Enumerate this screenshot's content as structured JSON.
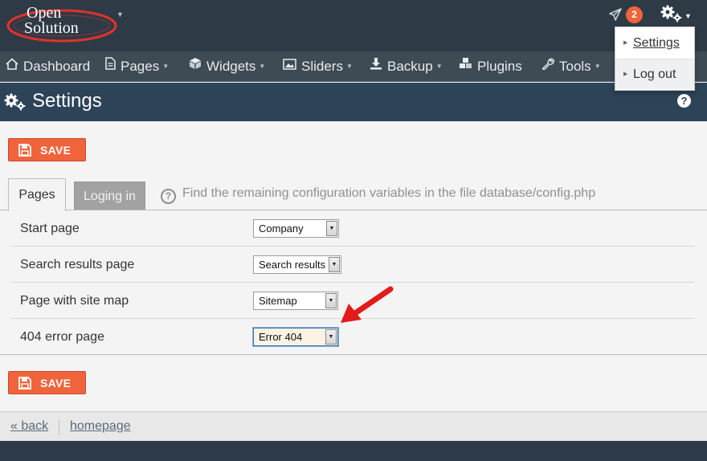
{
  "brand": {
    "logo_line1": "Open",
    "logo_line2": "Solution",
    "accent_color": "#f0643c"
  },
  "topbar": {
    "notification_icon": "paper-plane-icon",
    "notification_count": "2",
    "settings_icon": "gears-icon"
  },
  "settings_menu": {
    "items": [
      {
        "label": "Settings"
      },
      {
        "label": "Log out"
      }
    ]
  },
  "nav": {
    "items": [
      {
        "label": "Dashboard",
        "icon": "home-icon"
      },
      {
        "label": "Pages",
        "icon": "file-icon"
      },
      {
        "label": "Widgets",
        "icon": "cube-icon"
      },
      {
        "label": "Sliders",
        "icon": "image-icon"
      },
      {
        "label": "Backup",
        "icon": "download-icon"
      },
      {
        "label": "Plugins",
        "icon": "cubes-icon"
      },
      {
        "label": "Tools",
        "icon": "wrench-icon"
      }
    ]
  },
  "page": {
    "title": "Settings",
    "help": "?"
  },
  "buttons": {
    "save_label": "SAVE"
  },
  "tabs": {
    "items": [
      {
        "label": "Pages"
      },
      {
        "label": "Loging in"
      }
    ],
    "hint": "Find the remaining configuration variables in the file database/config.php"
  },
  "form": {
    "rows": [
      {
        "label": "Start page",
        "value": "Company"
      },
      {
        "label": "Search results page",
        "value": "Search results"
      },
      {
        "label": "Page with site map",
        "value": "Sitemap"
      },
      {
        "label": "404 error page",
        "value": "Error 404"
      }
    ]
  },
  "footer": {
    "back": "« back",
    "homepage": "homepage"
  }
}
